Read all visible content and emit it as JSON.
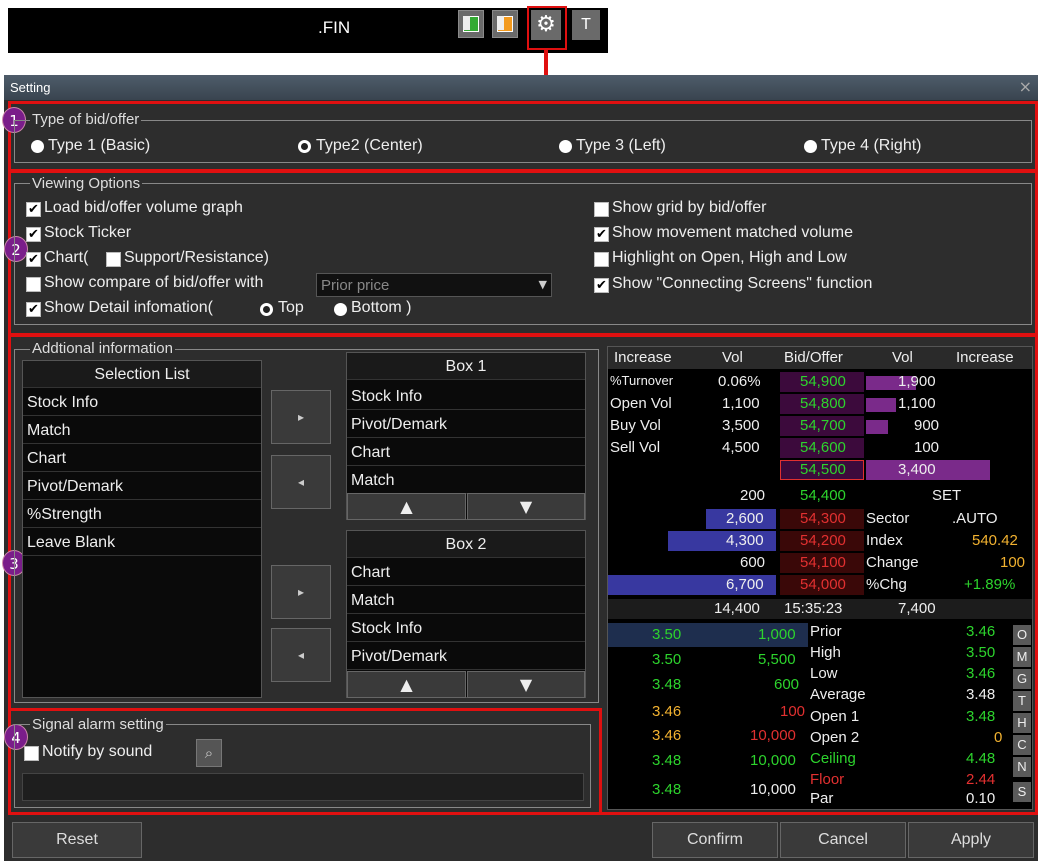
{
  "toolbar": {
    "symbol": ".FIN",
    "t_label": "T"
  },
  "window": {
    "title": "Setting",
    "close": "×"
  },
  "markers": [
    "1",
    "2",
    "3",
    "4"
  ],
  "bidoffer": {
    "legend": "Type of bid/offer",
    "options": [
      "Type 1 (Basic)",
      "Type2 (Center)",
      "Type 3 (Left)",
      "Type 4 (Right)"
    ],
    "selected": 1
  },
  "viewing": {
    "legend": "Viewing Options",
    "left": [
      "Load bid/offer volume graph",
      "Stock Ticker",
      "Chart(",
      "Support/Resistance)",
      "Show compare of bid/offer with",
      "Show Detail infomation(",
      "Top",
      "Bottom )"
    ],
    "compare_select": "Prior price",
    "right": [
      "Show grid by bid/offer",
      "Show movement matched volume",
      "Highlight on Open, High and Low",
      "Show \"Connecting Screens\" function"
    ]
  },
  "addl": {
    "legend": "Addtional information",
    "selection_header": "Selection List",
    "selection": [
      "Stock Info",
      "Match",
      "Chart",
      "Pivot/Demark",
      "%Strength",
      "Leave Blank"
    ],
    "box1_title": "Box 1",
    "box1": [
      "Stock Info",
      "Pivot/Demark",
      "Chart",
      "Match"
    ],
    "box2_title": "Box 2",
    "box2": [
      "Chart",
      "Match",
      "Stock Info",
      "Pivot/Demark"
    ],
    "up": "▲",
    "down": "▼",
    "move_right": "▸",
    "move_left": "◂"
  },
  "signal": {
    "legend": "Signal alarm setting",
    "notify": "Notify by sound"
  },
  "preview": {
    "headers": [
      "Increase",
      "Vol",
      "Bid/Offer",
      "Vol",
      "Increase"
    ],
    "info_labels": [
      "%Turnover",
      "Open Vol",
      "Buy Vol",
      "Sell Vol"
    ],
    "info_values": [
      "0.06%",
      "1,100",
      "3,500",
      "4,500"
    ],
    "offers": [
      {
        "price": "54,900",
        "vol": "1,900"
      },
      {
        "price": "54,800",
        "vol": "1,100"
      },
      {
        "price": "54,700",
        "vol": "900"
      },
      {
        "price": "54,600",
        "vol": "100"
      },
      {
        "price": "54,500",
        "vol": "3,400"
      }
    ],
    "bids": [
      {
        "vol": "200",
        "price": "54,400"
      },
      {
        "vol": "2,600",
        "price": "54,300"
      },
      {
        "vol": "4,300",
        "price": "54,200"
      },
      {
        "vol": "600",
        "price": "54,100"
      },
      {
        "vol": "6,700",
        "price": "54,000"
      }
    ],
    "right_labels": [
      "SET",
      "Sector",
      ".AUTO",
      "Index",
      "540.42",
      "Change",
      "100",
      "%Chg",
      "+1.89%"
    ],
    "totals": [
      "14,400",
      "15:35:23",
      "7,400"
    ],
    "ticks": [
      {
        "p": "3.50",
        "v": "1,000"
      },
      {
        "p": "3.50",
        "v": "5,500"
      },
      {
        "p": "3.48",
        "v": "600"
      },
      {
        "p": "3.46",
        "v": "100"
      },
      {
        "p": "3.46",
        "v": "10,000"
      },
      {
        "p": "3.48",
        "v": "10,000"
      },
      {
        "p": "3.48",
        "v": "10,000"
      }
    ],
    "stats": [
      {
        "l": "Prior",
        "v": "3.46"
      },
      {
        "l": "High",
        "v": "3.50"
      },
      {
        "l": "Low",
        "v": "3.46"
      },
      {
        "l": "Average",
        "v": "3.48"
      },
      {
        "l": "Open 1",
        "v": "3.48"
      },
      {
        "l": "Open 2",
        "v": "0"
      },
      {
        "l": "Ceiling",
        "v": "4.48"
      },
      {
        "l": "Floor",
        "v": "2.44"
      },
      {
        "l": "Par",
        "v": "0.10"
      }
    ],
    "side": [
      "O",
      "M",
      "G",
      "T",
      "H",
      "C",
      "N",
      "S"
    ]
  },
  "buttons": {
    "reset": "Reset",
    "confirm": "Confirm",
    "cancel": "Cancel",
    "apply": "Apply"
  }
}
